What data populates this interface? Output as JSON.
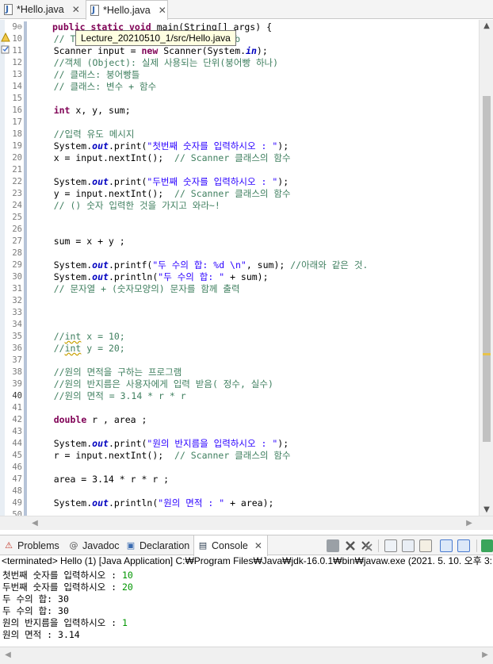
{
  "editor_tabs": [
    {
      "label": "*Hello.java",
      "active": false
    },
    {
      "label": "*Hello.java",
      "active": true
    }
  ],
  "tooltip": "Lecture_20210510_1/src/Hello.java",
  "line_numbers": [
    "9⊖",
    "10",
    "11",
    "12",
    "13",
    "14",
    "15",
    "16",
    "17",
    "18",
    "19",
    "20",
    "21",
    "22",
    "23",
    "24",
    "25",
    "26",
    "27",
    "28",
    "29",
    "30",
    "31",
    "32",
    "33",
    "34",
    "35",
    "36",
    "37",
    "38",
    "39",
    "40",
    "41",
    "42",
    "43",
    "44",
    "45",
    "46",
    "47",
    "48",
    "49",
    "50"
  ],
  "code": [
    "public static void main(String[] args) {",
    "    // TODO Auto-generated method stub",
    "    Scanner input = new Scanner(System.in);",
    "    //객체 (Object): 실제 사용되는 단위(붕어빵 하나)",
    "    // 클래스: 붕어빵틀",
    "    // 클래스: 변수 + 함수",
    "",
    "    int x, y, sum;",
    "",
    "    //입력 유도 메시지",
    "    System.out.print(\"첫번째 숫자를 입력하시오 : \");",
    "    x = input.nextInt();  // Scanner 클래스의 함수",
    "",
    "    System.out.print(\"두번째 숫자를 입력하시오 : \");",
    "    y = input.nextInt();  // Scanner 클래스의 함수",
    "    // () 숫자 입력한 것을 가지고 와라~!",
    "",
    "",
    "    sum = x + y ;",
    "",
    "    System.out.printf(\"두 수의 합: %d \\n\", sum); //아래와 같은 것.",
    "    System.out.println(\"두 수의 합: \" + sum);",
    "    // 문자열 + (숫자모양의) 문자를 함께 출력",
    "",
    "",
    "",
    "    //int x = 10;",
    "    //int y = 20;",
    "",
    "    //원의 면적을 구하는 프로그램",
    "    //원의 반지름은 사용자에게 입력 받음( 정수, 실수)",
    "    //원의 면적 = 3.14 * r * r",
    "",
    "    double r , area ;",
    "",
    "    System.out.print(\"원의 반지름을 입력하시오 : \");",
    "    r = input.nextInt();  // Scanner 클래스의 함수",
    "",
    "    area = 3.14 * r * r ;",
    "",
    "    System.out.println(\"원의 면적 : \" + area);",
    ""
  ],
  "panel_tabs": [
    {
      "label": "Problems",
      "icon": "problems-icon"
    },
    {
      "label": "Javadoc",
      "icon": "javadoc-icon"
    },
    {
      "label": "Declaration",
      "icon": "declaration-icon"
    },
    {
      "label": "Console",
      "icon": "console-icon",
      "active": true
    }
  ],
  "console_header": "<terminated> Hello (1) [Java Application] C:₩Program Files₩Java₩jdk-16.0.1₩bin₩javaw.exe  (2021. 5. 10. 오후 3:",
  "console_lines": [
    {
      "prompt": "첫번째 숫자를 입력하시오 : ",
      "input": "10"
    },
    {
      "prompt": "두번째 숫자를 입력하시오 : ",
      "input": "20"
    },
    {
      "prompt": "두 수의 합: 30",
      "input": ""
    },
    {
      "prompt": "두 수의 합: 30",
      "input": ""
    },
    {
      "prompt": "원의 반지름을 입력하시오 : ",
      "input": "1"
    },
    {
      "prompt": "원의 면적 : 3.14",
      "input": ""
    }
  ],
  "colors": {
    "keyword": "#7f0055",
    "comment": "#3f7f5f",
    "string": "#2a00ff",
    "field": "#0000c0",
    "console_input": "#009600"
  }
}
